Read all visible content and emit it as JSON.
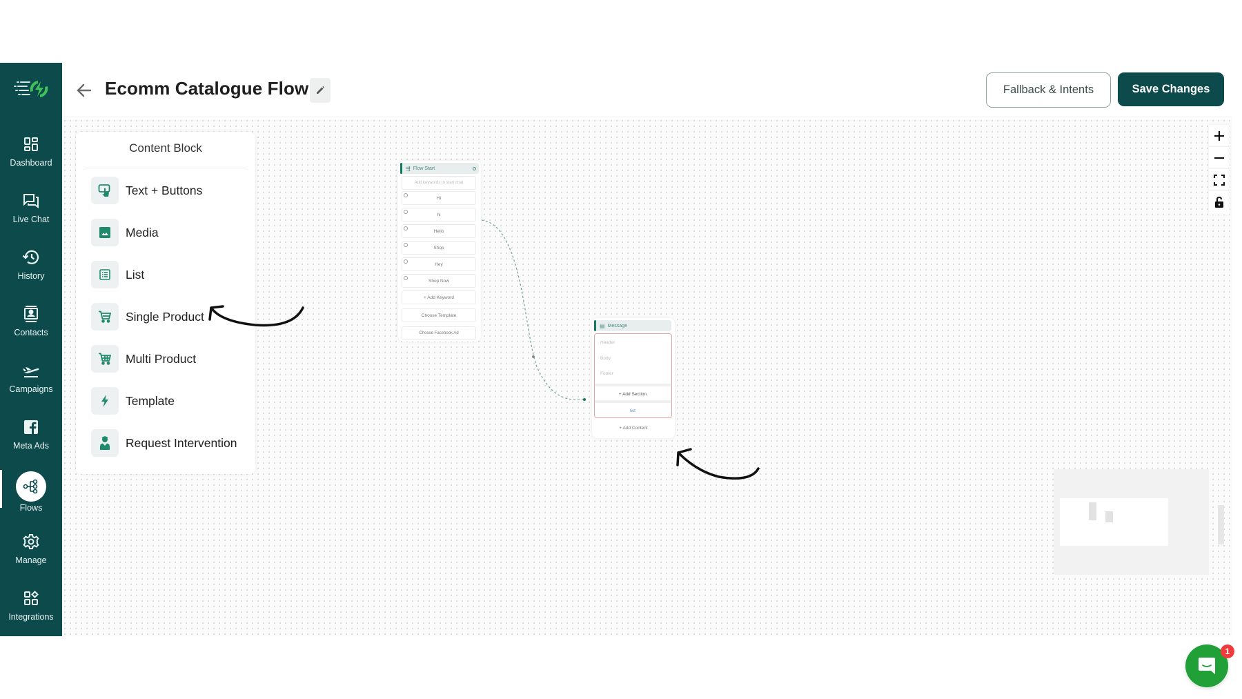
{
  "app": {
    "brand_colors": {
      "sidebar": "#0c4a4b",
      "primary": "#0c4a4b",
      "accent": "#127c61",
      "logo_green": "#3ec15a",
      "chat_green": "#21a038",
      "badge_red": "#ef3b3b"
    }
  },
  "sidebar": {
    "logo_icon": "brand-logo-icon",
    "items": [
      {
        "label": "Dashboard",
        "icon": "dashboard-grid-icon",
        "active": false
      },
      {
        "label": "Live Chat",
        "icon": "chat-bubbles-icon",
        "active": false
      },
      {
        "label": "History",
        "icon": "history-clock-icon",
        "active": false
      },
      {
        "label": "Contacts",
        "icon": "contact-card-icon",
        "active": false
      },
      {
        "label": "Campaigns",
        "icon": "plane-takeoff-icon",
        "active": false
      },
      {
        "label": "Meta Ads",
        "icon": "facebook-icon",
        "active": false
      },
      {
        "label": "Flows",
        "icon": "flow-tree-icon",
        "active": true
      },
      {
        "label": "Manage",
        "icon": "gear-icon",
        "active": false
      },
      {
        "label": "Integrations",
        "icon": "integrations-icon",
        "active": false
      }
    ]
  },
  "header": {
    "title": "Ecomm Catalogue Flow",
    "back_icon": "arrow-left-icon",
    "edit_icon": "pencil-icon",
    "fallback_button": "Fallback & Intents",
    "save_button": "Save Changes"
  },
  "content_panel": {
    "title": "Content Block",
    "items": [
      {
        "label": "Text + Buttons",
        "icon": "touch-screen-icon"
      },
      {
        "label": "Media",
        "icon": "image-icon"
      },
      {
        "label": "List",
        "icon": "list-icon"
      },
      {
        "label": "Single Product",
        "icon": "cart-icon"
      },
      {
        "label": "Multi Product",
        "icon": "cart-icon"
      },
      {
        "label": "Template",
        "icon": "lightning-icon"
      },
      {
        "label": "Request Intervention",
        "icon": "agent-icon"
      }
    ]
  },
  "flow_start_node": {
    "title": "Flow Start",
    "keyword_placeholder": "Add keywords to start chat",
    "keywords": [
      "Hi",
      "hi",
      "Hello",
      "Shop",
      "Hey",
      "Shop Now"
    ],
    "add_keyword": "+ Add Keyword",
    "choose_template": "Choose Template",
    "choose_facebook_ad": "Choose Facebook Ad"
  },
  "message_node": {
    "title": "Message",
    "header_placeholder": "Header",
    "body_placeholder": "Body",
    "footer_placeholder": "Footer",
    "add_section": "+ Add Section",
    "list_button": "list",
    "add_content": "+ Add Content"
  },
  "zoom_controls": {
    "zoom_in_icon": "plus-icon",
    "zoom_out_icon": "minus-icon",
    "fit_view_icon": "fit-view-icon",
    "lock_icon": "unlock-icon"
  },
  "chat_widget": {
    "icon": "chat-support-icon",
    "badge_count": "1"
  }
}
